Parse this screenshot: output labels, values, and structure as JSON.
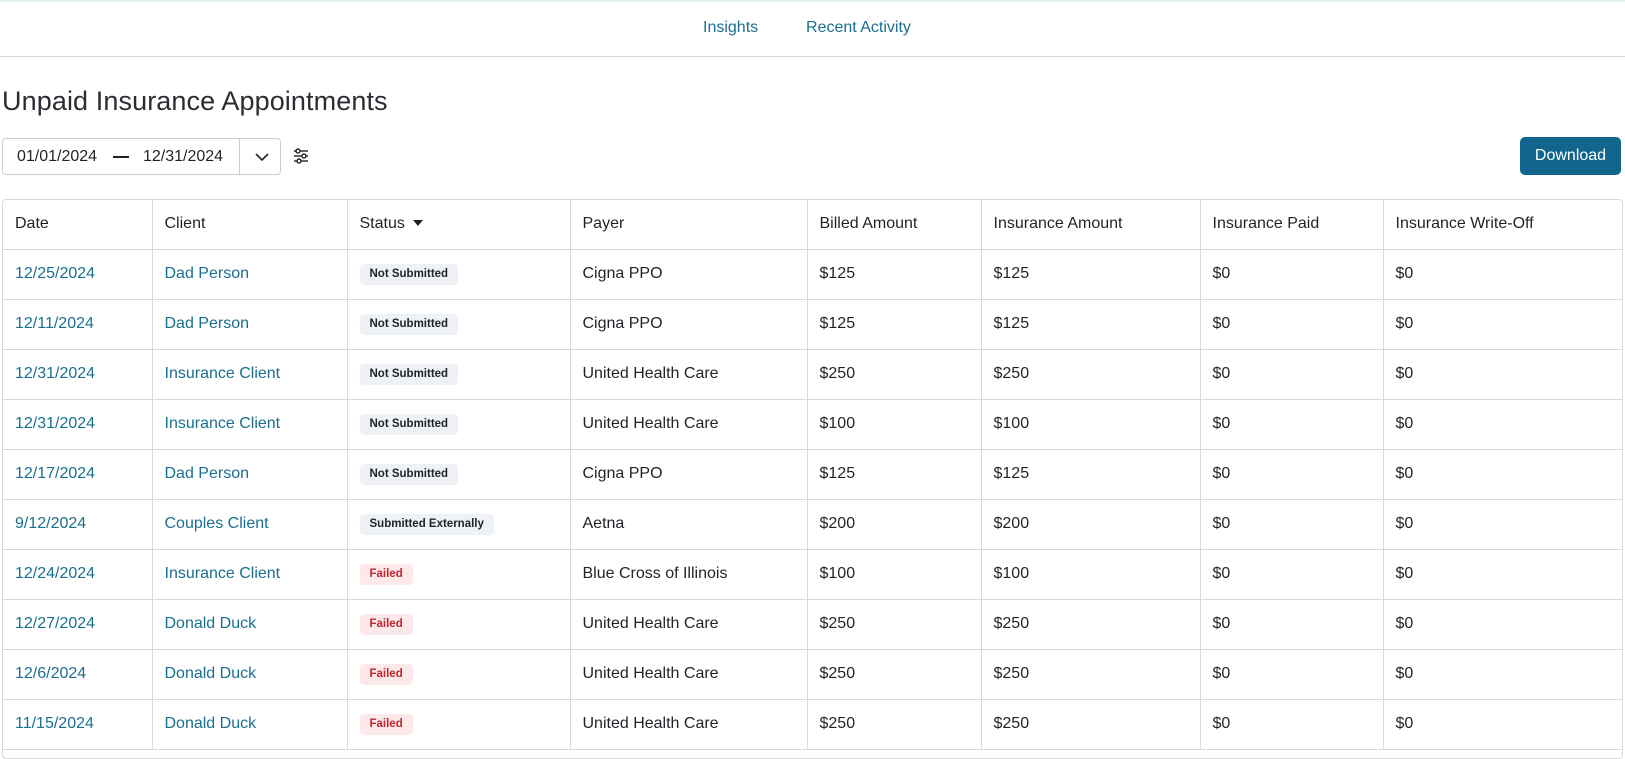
{
  "nav": {
    "tabs": [
      {
        "label": "Insights"
      },
      {
        "label": "Recent Activity"
      }
    ]
  },
  "page": {
    "title": "Unpaid Insurance Appointments"
  },
  "date_range": {
    "start": "01/01/2024",
    "end": "12/31/2024"
  },
  "toolbar": {
    "download_label": "Download"
  },
  "colors": {
    "accent": "#12668e",
    "link": "#1a6f8e",
    "failed_text": "#c2262e",
    "failed_bg": "#fde8ea",
    "neutral_badge_bg": "#eef2f6"
  },
  "table": {
    "columns": [
      "Date",
      "Client",
      "Status",
      "Payer",
      "Billed Amount",
      "Insurance Amount",
      "Insurance Paid",
      "Insurance Write-Off"
    ],
    "rows": [
      {
        "date": "12/25/2024",
        "client": "Dad Person",
        "status": "Not Submitted",
        "payer": "Cigna PPO",
        "billed": "$125",
        "ins_amount": "$125",
        "ins_paid": "$0",
        "write_off": "$0"
      },
      {
        "date": "12/11/2024",
        "client": "Dad Person",
        "status": "Not Submitted",
        "payer": "Cigna PPO",
        "billed": "$125",
        "ins_amount": "$125",
        "ins_paid": "$0",
        "write_off": "$0"
      },
      {
        "date": "12/31/2024",
        "client": "Insurance Client",
        "status": "Not Submitted",
        "payer": "United Health Care",
        "billed": "$250",
        "ins_amount": "$250",
        "ins_paid": "$0",
        "write_off": "$0"
      },
      {
        "date": "12/31/2024",
        "client": "Insurance Client",
        "status": "Not Submitted",
        "payer": "United Health Care",
        "billed": "$100",
        "ins_amount": "$100",
        "ins_paid": "$0",
        "write_off": "$0"
      },
      {
        "date": "12/17/2024",
        "client": "Dad Person",
        "status": "Not Submitted",
        "payer": "Cigna PPO",
        "billed": "$125",
        "ins_amount": "$125",
        "ins_paid": "$0",
        "write_off": "$0"
      },
      {
        "date": "9/12/2024",
        "client": "Couples Client",
        "status": "Submitted Externally",
        "payer": "Aetna",
        "billed": "$200",
        "ins_amount": "$200",
        "ins_paid": "$0",
        "write_off": "$0"
      },
      {
        "date": "12/24/2024",
        "client": "Insurance Client",
        "status": "Failed",
        "payer": "Blue Cross of Illinois",
        "billed": "$100",
        "ins_amount": "$100",
        "ins_paid": "$0",
        "write_off": "$0"
      },
      {
        "date": "12/27/2024",
        "client": "Donald Duck",
        "status": "Failed",
        "payer": "United Health Care",
        "billed": "$250",
        "ins_amount": "$250",
        "ins_paid": "$0",
        "write_off": "$0"
      },
      {
        "date": "12/6/2024",
        "client": "Donald Duck",
        "status": "Failed",
        "payer": "United Health Care",
        "billed": "$250",
        "ins_amount": "$250",
        "ins_paid": "$0",
        "write_off": "$0"
      },
      {
        "date": "11/15/2024",
        "client": "Donald Duck",
        "status": "Failed",
        "payer": "United Health Care",
        "billed": "$250",
        "ins_amount": "$250",
        "ins_paid": "$0",
        "write_off": "$0"
      }
    ]
  }
}
